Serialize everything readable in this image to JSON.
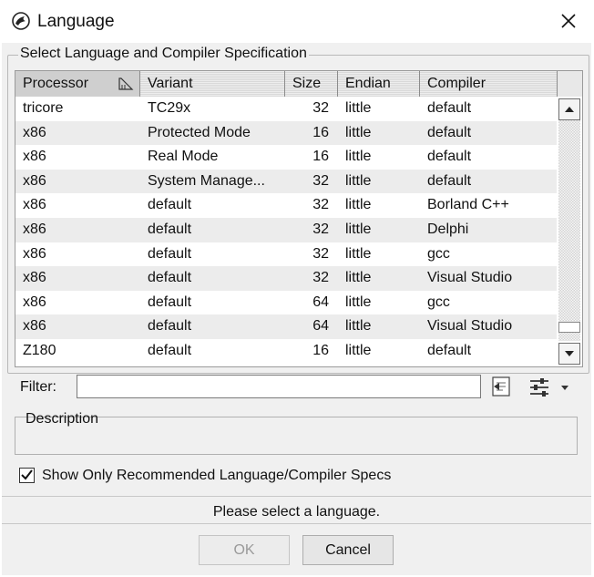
{
  "window": {
    "title": "Language"
  },
  "section": {
    "legend": "Select Language and Compiler Specification"
  },
  "table": {
    "columns": [
      "Processor",
      "Variant",
      "Size",
      "Endian",
      "Compiler"
    ],
    "rows": [
      [
        "tricore",
        "TC29x",
        "32",
        "little",
        "default"
      ],
      [
        "x86",
        "Protected Mode",
        "16",
        "little",
        "default"
      ],
      [
        "x86",
        "Real Mode",
        "16",
        "little",
        "default"
      ],
      [
        "x86",
        "System Manage...",
        "32",
        "little",
        "default"
      ],
      [
        "x86",
        "default",
        "32",
        "little",
        "Borland C++"
      ],
      [
        "x86",
        "default",
        "32",
        "little",
        "Delphi"
      ],
      [
        "x86",
        "default",
        "32",
        "little",
        "gcc"
      ],
      [
        "x86",
        "default",
        "32",
        "little",
        "Visual Studio"
      ],
      [
        "x86",
        "default",
        "64",
        "little",
        "gcc"
      ],
      [
        "x86",
        "default",
        "64",
        "little",
        "Visual Studio"
      ],
      [
        "Z180",
        "default",
        "16",
        "little",
        "default"
      ]
    ]
  },
  "filter": {
    "label": "Filter:",
    "value": ""
  },
  "description": {
    "legend": "Description"
  },
  "recommended": {
    "label": "Show Only Recommended Language/Compiler Specs",
    "checked": true
  },
  "status": {
    "text": "Please select a language."
  },
  "buttons": {
    "ok": "OK",
    "cancel": "Cancel"
  }
}
